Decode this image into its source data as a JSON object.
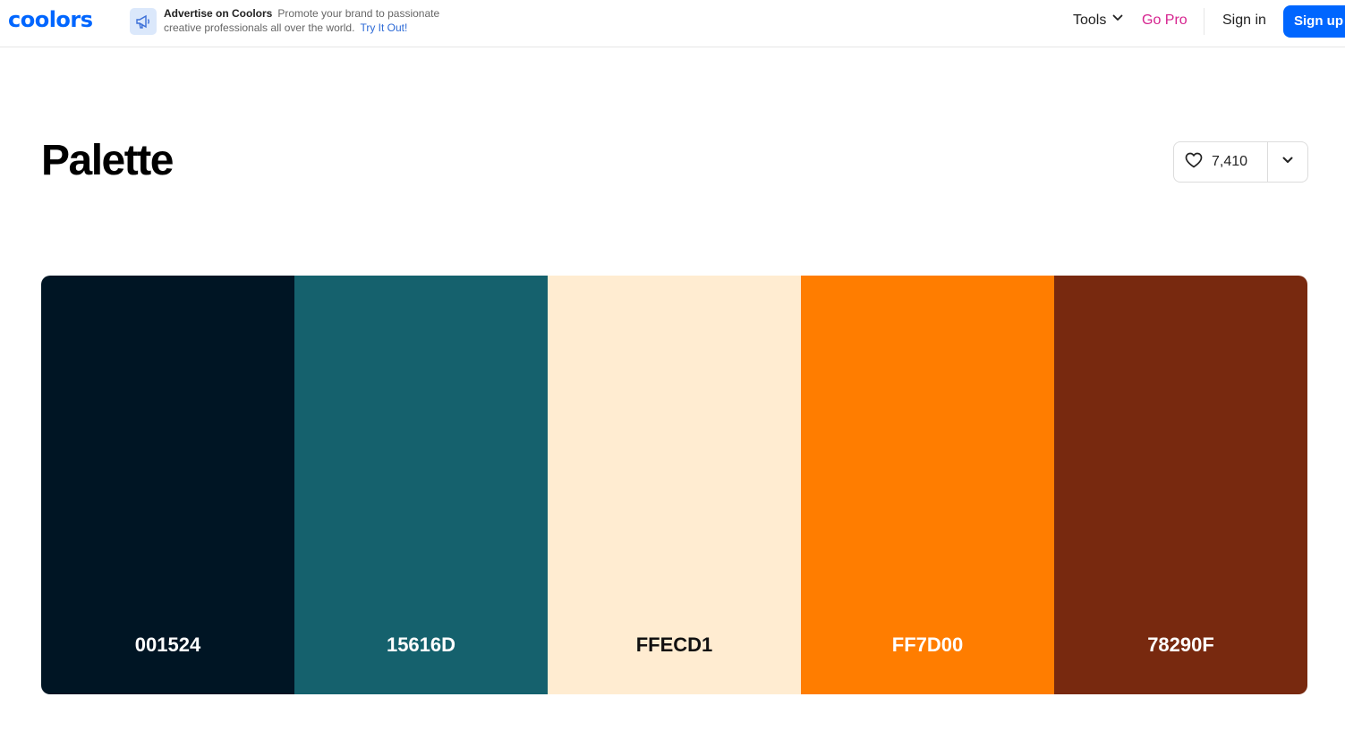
{
  "header": {
    "logo_text": "coolors",
    "logo_color": "#0066ff",
    "ad_icon": "megaphone-icon",
    "ad_title": "Advertise on Coolors",
    "ad_body": "Promote your brand to passionate creative professionals all over the world.",
    "ad_link": "Try It Out!",
    "tools_label": "Tools",
    "tools_icon": "chevron-down-icon",
    "gopro_label": "Go Pro",
    "gopro_color": "#d6238f",
    "signin_label": "Sign in",
    "signup_label": "Sign up",
    "signup_color": "#0066ff"
  },
  "main": {
    "title": "Palette",
    "likes": "7,410",
    "like_icon": "heart-icon",
    "more_icon": "chevron-down-icon"
  },
  "palette": {
    "swatches": [
      {
        "hex": "001524",
        "color": "#001524",
        "text_color": "#ffffff"
      },
      {
        "hex": "15616D",
        "color": "#15616D",
        "text_color": "#ffffff"
      },
      {
        "hex": "FFECD1",
        "color": "#FFECD1",
        "text_color": "#111111"
      },
      {
        "hex": "FF7D00",
        "color": "#FF7D00",
        "text_color": "#ffffff"
      },
      {
        "hex": "78290F",
        "color": "#78290F",
        "text_color": "#ffffff"
      }
    ]
  }
}
